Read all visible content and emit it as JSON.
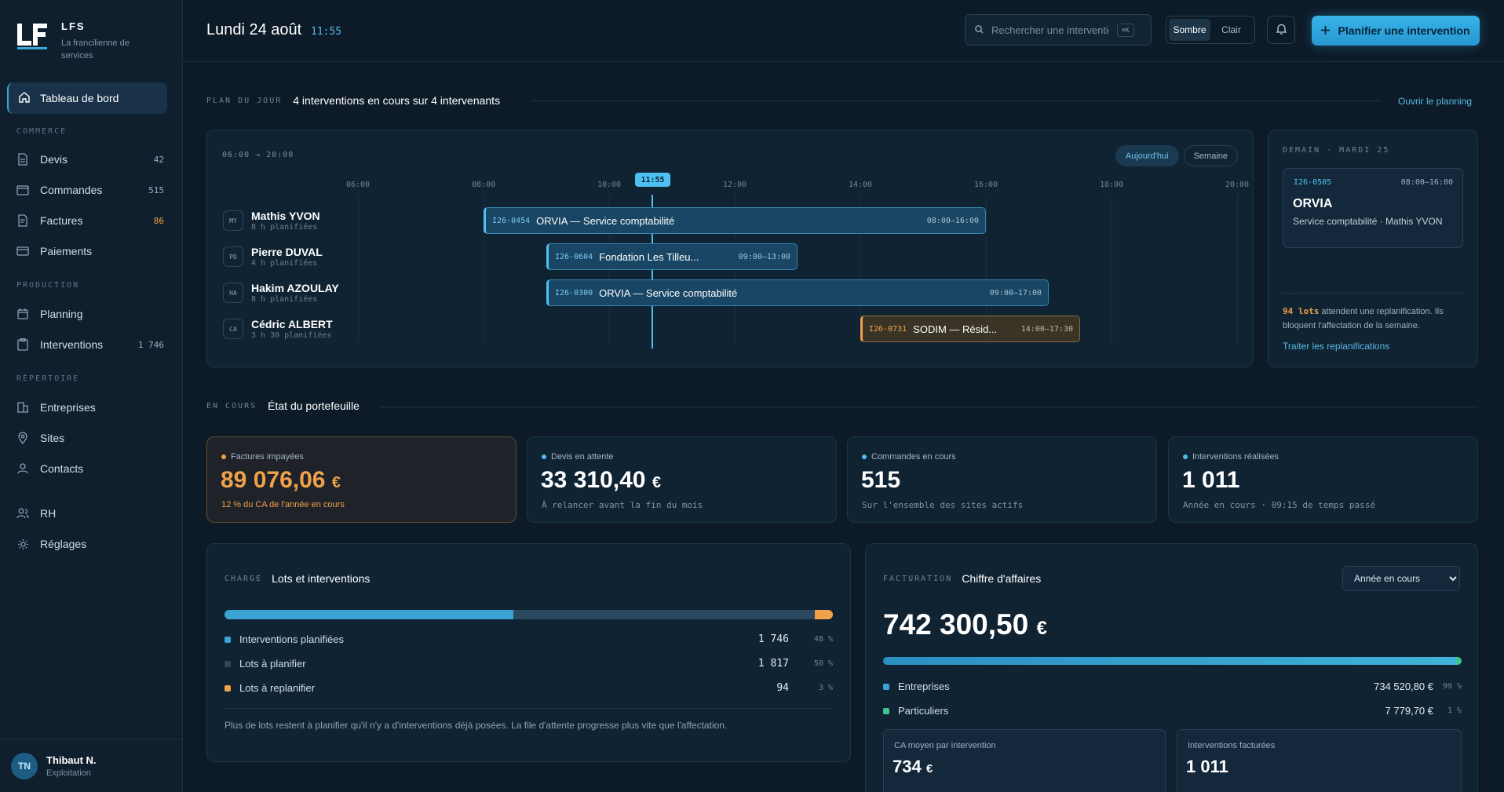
{
  "brand": {
    "name": "LFS",
    "subtitle": "La francilienne de services"
  },
  "sidebar": {
    "active": "Tableau de bord",
    "sections": {
      "commerce": "COMMERCE",
      "production": "PRODUCTION",
      "repertoire": "RÉPERTOIRE"
    },
    "items": {
      "devis": {
        "label": "Devis",
        "count": "42"
      },
      "commandes": {
        "label": "Commandes",
        "count": "515"
      },
      "factures": {
        "label": "Factures",
        "count": "86"
      },
      "paiements": {
        "label": "Paiements"
      },
      "planning": {
        "label": "Planning"
      },
      "interventions": {
        "label": "Interventions",
        "count": "1 746"
      },
      "entreprises": {
        "label": "Entreprises"
      },
      "sites": {
        "label": "Sites"
      },
      "contacts": {
        "label": "Contacts"
      },
      "rh": {
        "label": "RH"
      },
      "reglages": {
        "label": "Réglages"
      }
    },
    "user": {
      "initials": "TN",
      "name": "Thibaut N.",
      "role": "Exploitation"
    }
  },
  "header": {
    "date": "Lundi 24 août",
    "time": "11:55",
    "search_placeholder": "Rechercher une intervention",
    "shortcut": "⌘K",
    "theme": {
      "dark": "Sombre",
      "light": "Clair"
    },
    "cta": "Planifier une intervention"
  },
  "plan": {
    "kicker": "PLAN DU JOUR",
    "title": "4 interventions en cours sur 4 intervenants",
    "open_link": "Ouvrir le planning",
    "range": "06:00 → 20:00",
    "views": {
      "today": "Aujourd'hui",
      "week": "Semaine"
    },
    "now": "11:55",
    "hours": [
      "06:00",
      "08:00",
      "10:00",
      "12:00",
      "14:00",
      "16:00",
      "18:00",
      "20:00"
    ],
    "technicians": [
      {
        "initials": "MY",
        "name": "Mathis YVON",
        "planned": "8 h planifiées"
      },
      {
        "initials": "PD",
        "name": "Pierre DUVAL",
        "planned": "4 h planifiées"
      },
      {
        "initials": "HA",
        "name": "Hakim AZOULAY",
        "planned": "8 h planifiées"
      },
      {
        "initials": "CA",
        "name": "Cédric ALBERT",
        "planned": "3 h 30 planifiées"
      }
    ],
    "jobs": [
      {
        "code": "I26-0454",
        "label": "ORVIA — Service comptabilité",
        "hours": "08:00–16:00",
        "start": 8,
        "end": 16,
        "row": 0,
        "status": "active"
      },
      {
        "code": "I26-0604",
        "label": "Fondation Les Tilleu...",
        "hours": "09:00–13:00",
        "start": 9,
        "end": 13,
        "row": 1,
        "status": "active"
      },
      {
        "code": "I26-0300",
        "label": "ORVIA — Service comptabilité",
        "hours": "09:00–17:00",
        "start": 9,
        "end": 17,
        "row": 2,
        "status": "active"
      },
      {
        "code": "I26-0731",
        "label": "SODIM — Résid...",
        "hours": "14:00–17:30",
        "start": 14,
        "end": 17.5,
        "row": 3,
        "status": "warning"
      }
    ]
  },
  "tomorrow": {
    "kicker": "DEMAIN · MARDI 25",
    "code": "I26-0505",
    "hours": "08:00–16:00",
    "title": "ORVIA",
    "desc": "Service comptabilité · Mathis YVON",
    "note_highlight": "94 lots",
    "note_rest": "attendent une replanification. Ils bloquent l'affectation de la semaine.",
    "link": "Traiter les replanifications"
  },
  "portfolio": {
    "kicker": "EN COURS",
    "title": "État du portefeuille",
    "kpis": [
      {
        "label": "Factures impayées",
        "value": "89 076,06",
        "currency": "€",
        "sub": "12 % du CA de l'année en cours"
      },
      {
        "label": "Devis en attente",
        "value": "33 310,40",
        "currency": "€",
        "sub": "À relancer avant la fin du mois"
      },
      {
        "label": "Commandes en cours",
        "value": "515",
        "currency": "",
        "sub": "Sur l'ensemble des sites actifs"
      },
      {
        "label": "Interventions réalisées",
        "value": "1 011",
        "currency": "",
        "sub": "Année en cours · 09:15 de temps passé"
      }
    ]
  },
  "charge": {
    "kicker": "CHARGE",
    "title": "Lots et interventions",
    "rows": [
      {
        "label": "Interventions planifiées",
        "value": "1 746",
        "pct": "48 %",
        "share": 48,
        "color": "#3aa3d4"
      },
      {
        "label": "Lots à planifier",
        "value": "1 817",
        "pct": "50 %",
        "share": 50,
        "color": "#2b4a60"
      },
      {
        "label": "Lots à replanifier",
        "value": "94",
        "pct": "3 %",
        "share": 3,
        "color": "#f0a14a"
      }
    ],
    "note": "Plus de lots restent à planifier qu'il n'y a d'interventions déjà posées. La file d'attente progresse plus vite que l'affectation."
  },
  "revenue": {
    "kicker": "FACTURATION",
    "title": "Chiffre d'affaires",
    "period": "Année en cours",
    "total": "742 300,50",
    "currency": "€",
    "rows": [
      {
        "label": "Entreprises",
        "value": "734 520,80 €",
        "pct": "99 %",
        "share": 99,
        "color": "#3aa3d4"
      },
      {
        "label": "Particuliers",
        "value": "7 779,70 €",
        "pct": "1 %",
        "share": 1,
        "color": "#3fc491"
      }
    ],
    "avg": {
      "label": "CA moyen par intervention",
      "value": "734",
      "currency": "€"
    },
    "billed": {
      "label": "Interventions facturées",
      "value": "1 011"
    }
  }
}
